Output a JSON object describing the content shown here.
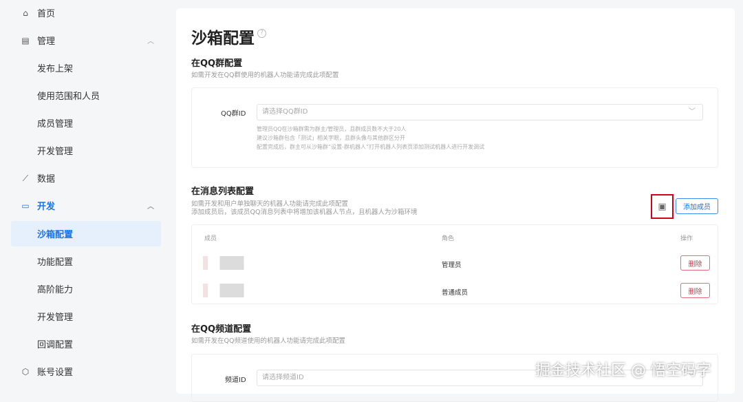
{
  "sidebar": {
    "items": [
      {
        "label": "首页",
        "icon": "home-icon"
      },
      {
        "label": "管理",
        "icon": "document-icon"
      },
      {
        "label": "发布上架"
      },
      {
        "label": "使用范围和人员"
      },
      {
        "label": "成员管理"
      },
      {
        "label": "开发管理"
      },
      {
        "label": "数据",
        "icon": "chart-icon"
      },
      {
        "label": "开发",
        "icon": "monitor-icon"
      },
      {
        "label": "沙箱配置"
      },
      {
        "label": "功能配置"
      },
      {
        "label": "高阶能力"
      },
      {
        "label": "开发管理"
      },
      {
        "label": "回调配置"
      },
      {
        "label": "账号设置",
        "icon": "account-icon"
      }
    ]
  },
  "page": {
    "title": "沙箱配置",
    "help": "?"
  },
  "qq_group": {
    "title": "在QQ群配置",
    "desc": "如需开发在QQ群使用的机器人功能请完成此项配置",
    "label": "QQ群ID",
    "placeholder": "请选择QQ群ID",
    "tips": [
      "管理员QQ在沙箱群需为群主/管理员，且群成员数不大于20人",
      "建议沙箱群包含「测试」相关字眼，且群头像与其他群区分开",
      "配置完成后，群主可从沙箱群“设置-群机器人”打开机器人列表页添加测试机器人进行开发调试"
    ]
  },
  "message_list": {
    "title": "在消息列表配置",
    "desc1": "如需开发和用户单独聊天的机器人功能请完成此项配置",
    "desc2": "添加成员后，该成员QQ消息列表中将增加该机器人节点，且机器人为沙箱环境",
    "add_button": "添加成员",
    "columns": [
      "成员",
      "角色",
      "操作"
    ],
    "rows": [
      {
        "role": "管理员",
        "action": "删除"
      },
      {
        "role": "普通成员",
        "action": "删除"
      }
    ]
  },
  "channel": {
    "title": "在QQ频道配置",
    "desc": "如需开发在QQ频道使用的机器人功能请完成此项配置",
    "label": "频道ID",
    "placeholder": "请选择频道ID"
  },
  "watermark": "掘金技术社区 @ 悟空码字"
}
